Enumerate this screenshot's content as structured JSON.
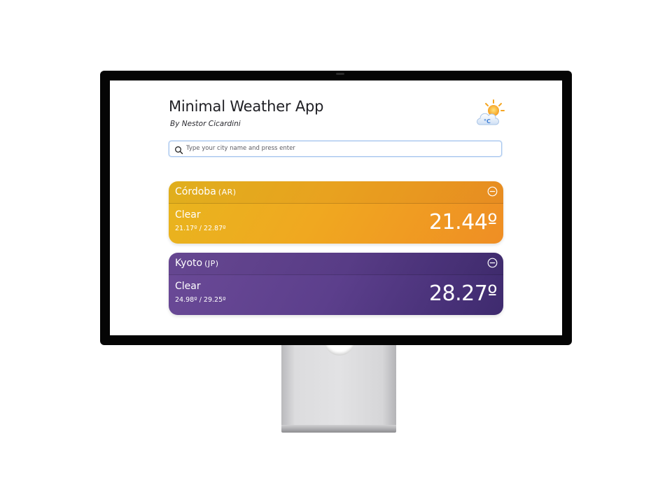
{
  "app": {
    "title": "Minimal Weather App",
    "subtitle": "By Nestor Cicardini",
    "logo_icon": "sun-cloud-celsius-icon"
  },
  "search": {
    "placeholder": "Type your city name and press enter",
    "value": ""
  },
  "cities": [
    {
      "name": "Córdoba",
      "country": "(AR)",
      "condition": "Clear",
      "minmax": "21.17º / 22.87º",
      "temp": "21.44º",
      "gradient": [
        "#e8b51e",
        "#ef8e24"
      ]
    },
    {
      "name": "Kyoto",
      "country": "(JP)",
      "condition": "Clear",
      "minmax": "24.98º / 29.25º",
      "temp": "28.27º",
      "gradient": [
        "#6b4a97",
        "#3e2a6e"
      ]
    }
  ],
  "colors": {
    "bezel": "#050505",
    "search_border": "#a9c7ef"
  }
}
